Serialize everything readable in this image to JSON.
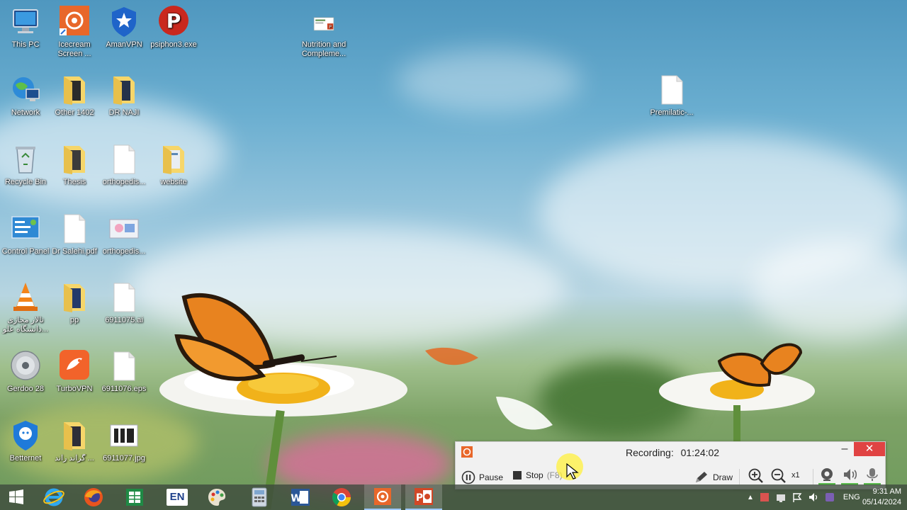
{
  "desktop": {
    "icons": [
      {
        "id": "this-pc",
        "label": "This PC"
      },
      {
        "id": "icecream",
        "label": "Icecream Screen ..."
      },
      {
        "id": "amanvpn",
        "label": "AmanVPN"
      },
      {
        "id": "psiphon",
        "label": "psiphon3.exe"
      },
      {
        "id": "nutrition",
        "label": "Nutrition and Compleme..."
      },
      {
        "id": "network",
        "label": "Network"
      },
      {
        "id": "other1402",
        "label": "Other 1402"
      },
      {
        "id": "drnaji",
        "label": "DR NAJI"
      },
      {
        "id": "premilatic",
        "label": "Premilatic-..."
      },
      {
        "id": "recycle",
        "label": "Recycle Bin"
      },
      {
        "id": "thesis",
        "label": "Thesis"
      },
      {
        "id": "orthopedis1",
        "label": "orthopedis..."
      },
      {
        "id": "website",
        "label": "website"
      },
      {
        "id": "control-panel",
        "label": "Control Panel"
      },
      {
        "id": "drsalehi",
        "label": "Dr Salehi.pdf"
      },
      {
        "id": "orthopedis2",
        "label": "orthopedis..."
      },
      {
        "id": "vlc",
        "label": "تالار مجازی دانشگاه علو..."
      },
      {
        "id": "pp",
        "label": "pp"
      },
      {
        "id": "file6911075",
        "label": "6911075.ai"
      },
      {
        "id": "gerdoo",
        "label": "Gerdoo 28"
      },
      {
        "id": "turbovpn",
        "label": "TurboVPN"
      },
      {
        "id": "file6911076",
        "label": "6911076.eps"
      },
      {
        "id": "betternet",
        "label": "Betternet"
      },
      {
        "id": "grand-round",
        "label": "گراند راند ..."
      },
      {
        "id": "file6911077",
        "label": "6911077.jpg"
      }
    ]
  },
  "recorder": {
    "recording_label": "Recording:",
    "time": "01:24:02",
    "minimize": "–",
    "close": "✕",
    "pause_label": "Pause",
    "stop_label": "Stop",
    "stop_hotkey": "(F8)",
    "draw_label": "Draw",
    "zoom_level": "x1"
  },
  "taskbar": {
    "pinned": [
      "start",
      "internet-explorer",
      "firefox",
      "excel",
      "language-en",
      "paint",
      "calculator",
      "word",
      "chrome",
      "icecream-recorder",
      "powerpoint"
    ],
    "lang_button": "EN",
    "tray": {
      "language": "ENG",
      "time": "9:31 AM",
      "date": "05/14/2024"
    }
  },
  "colors": {
    "recorder_close": "#e04343",
    "recorder_accent": "#e8672a",
    "audio_level": "#59b94c"
  }
}
